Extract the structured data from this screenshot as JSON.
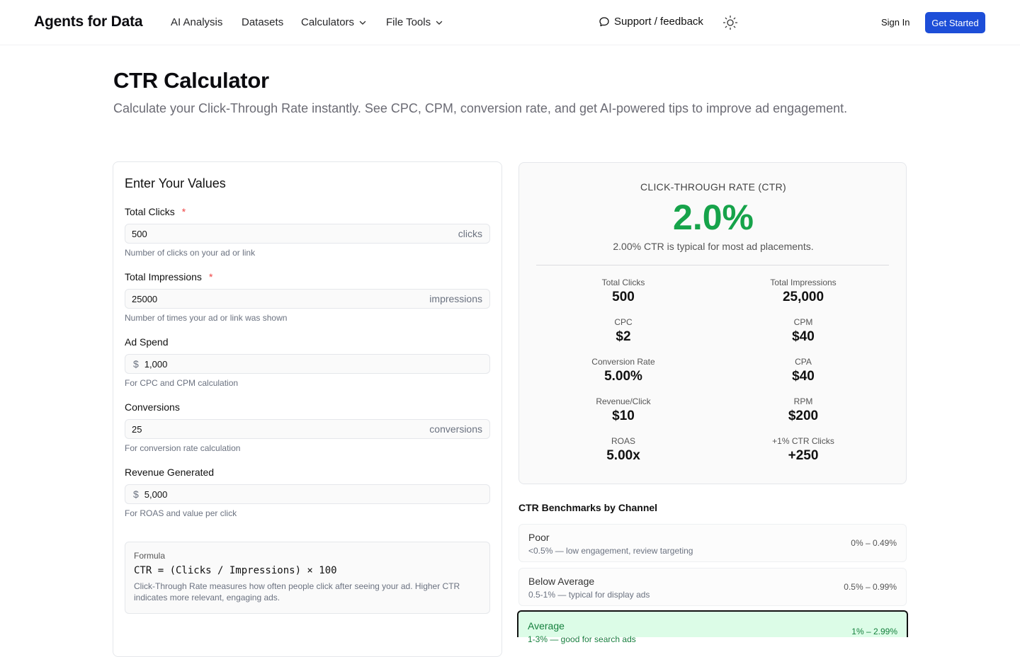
{
  "nav": {
    "brand": "Agents for Data",
    "links": [
      "AI Analysis",
      "Datasets",
      "Calculators",
      "File Tools"
    ],
    "support": "Support / feedback",
    "sign_in": "Sign In",
    "get_started": "Get Started"
  },
  "header": {
    "title": "CTR Calculator",
    "subtitle": "Calculate your Click-Through Rate instantly. See CPC, CPM, conversion rate, and get AI-powered tips to improve ad engagement."
  },
  "form": {
    "title": "Enter Your Values",
    "fields": [
      {
        "label": "Total Clicks",
        "required": "*",
        "value": "500",
        "unit": "clicks",
        "prefix": "",
        "hint": "Number of clicks on your ad or link"
      },
      {
        "label": "Total Impressions",
        "required": "*",
        "value": "25000",
        "unit": "impressions",
        "prefix": "",
        "hint": "Number of times your ad or link was shown"
      },
      {
        "label": "Ad Spend",
        "required": "",
        "value": "1,000",
        "unit": "",
        "prefix": "$",
        "hint": "For CPC and CPM calculation"
      },
      {
        "label": "Conversions",
        "required": "",
        "value": "25",
        "unit": "conversions",
        "prefix": "",
        "hint": "For conversion rate calculation"
      },
      {
        "label": "Revenue Generated",
        "required": "",
        "value": "5,000",
        "unit": "",
        "prefix": "$",
        "hint": "For ROAS and value per click"
      }
    ],
    "formula": {
      "label": "Formula",
      "code": "CTR = (Clicks / Impressions) × 100",
      "description": "Click-Through Rate measures how often people click after seeing your ad. Higher CTR indicates more relevant, engaging ads."
    }
  },
  "result": {
    "label": "CLICK-THROUGH RATE (CTR)",
    "value": "2.0%",
    "note": "2.00% CTR is typical for most ad placements.",
    "stats": [
      {
        "label": "Total Clicks",
        "value": "500"
      },
      {
        "label": "Total Impressions",
        "value": "25,000"
      },
      {
        "label": "CPC",
        "value": "$2"
      },
      {
        "label": "CPM",
        "value": "$40"
      },
      {
        "label": "Conversion Rate",
        "value": "5.00%"
      },
      {
        "label": "CPA",
        "value": "$40"
      },
      {
        "label": "Revenue/Click",
        "value": "$10"
      },
      {
        "label": "RPM",
        "value": "$200"
      },
      {
        "label": "ROAS",
        "value": "5.00x"
      },
      {
        "label": "+1% CTR Clicks",
        "value": "+250"
      }
    ]
  },
  "benchmarks": {
    "title": "CTR Benchmarks by Channel",
    "items": [
      {
        "name": "Poor",
        "desc": "<0.5% — low engagement, review targeting",
        "range": "0% – 0.49%"
      },
      {
        "name": "Below Average",
        "desc": "0.5-1% — typical for display ads",
        "range": "0.5% – 0.99%"
      },
      {
        "name": "Average",
        "desc": "1-3% — good for search ads",
        "range": "1% – 2.99%"
      }
    ]
  },
  "colors": {
    "accent": "#1d4ed8",
    "success": "#16a34a",
    "active_bg": "#dcfce7"
  }
}
